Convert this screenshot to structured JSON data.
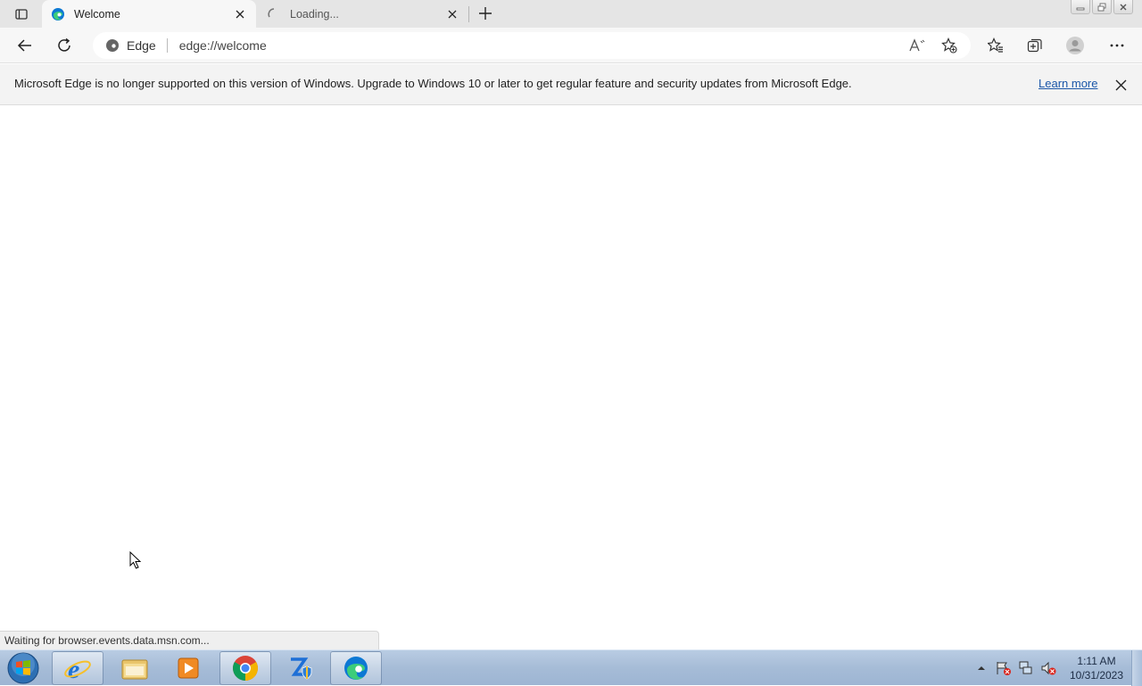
{
  "browser": {
    "tabs": [
      {
        "title": "Welcome",
        "active": true
      },
      {
        "title": "Loading...",
        "active": false
      }
    ],
    "address": {
      "site_label": "Edge",
      "url": "edge://welcome"
    },
    "icons": {
      "tab_actions": "tab-actions-icon",
      "new_tab": "plus-icon",
      "back": "back-arrow-icon",
      "refresh": "refresh-icon",
      "read_aloud": "read-aloud-icon",
      "add_favorite": "star-plus-icon",
      "favorites": "favorites-icon",
      "collections": "collections-icon",
      "profile": "profile-icon",
      "more": "ellipsis-icon"
    }
  },
  "infobar": {
    "message": "Microsoft Edge is no longer supported on this version of Windows. Upgrade to Windows 10 or later to get regular feature and security updates from Microsoft Edge.",
    "link_label": "Learn more"
  },
  "status": {
    "text": "Waiting for browser.events.data.msn.com..."
  },
  "taskbar": {
    "apps": [
      "internet-explorer",
      "file-explorer",
      "media-player",
      "chrome",
      "installer-shield",
      "edge"
    ],
    "clock": {
      "time": "1:11 AM",
      "date": "10/31/2023"
    }
  },
  "colors": {
    "link": "#1a56a8",
    "taskbar": "#a6bcd7",
    "edge_blue": "#0c78d4",
    "edge_green": "#3ccd7a"
  }
}
